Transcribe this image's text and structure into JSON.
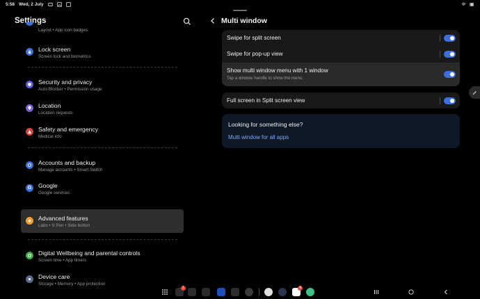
{
  "statusbar": {
    "time": "5:58",
    "date": "Wed, 2 July"
  },
  "left": {
    "title": "Settings",
    "items": [
      {
        "title": "",
        "sub": "Layout • App icon badges",
        "color": "#3d6fde"
      },
      {
        "title": "Lock screen",
        "sub": "Screen lock and biometrics",
        "color": "#3d6fde"
      },
      {
        "title": "Security and privacy",
        "sub": "Auto Blocker • Permission usage",
        "color": "#5b5fe0"
      },
      {
        "title": "Location",
        "sub": "Location requests",
        "color": "#7b5fd6"
      },
      {
        "title": "Safety and emergency",
        "sub": "Medical info",
        "color": "#d6443d"
      },
      {
        "title": "Accounts and backup",
        "sub": "Manage accounts • Smart Switch",
        "color": "#3d6fde"
      },
      {
        "title": "Google",
        "sub": "Google services",
        "color": "#3d6fde"
      },
      {
        "title": "Advanced features",
        "sub": "Labs • S Pen • Side button",
        "color": "#f0a030"
      },
      {
        "title": "Digital Wellbeing and parental controls",
        "sub": "Screen time • App timers",
        "color": "#3fae45"
      },
      {
        "title": "Device care",
        "sub": "Storage • Memory • App protection",
        "color": "#5a6a8c"
      }
    ]
  },
  "right": {
    "title": "Multi window",
    "rows": [
      {
        "label": "Swipe for split screen",
        "on": true
      },
      {
        "label": "Swipe for pop-up view",
        "on": true
      },
      {
        "label": "Show multi window menu with 1 window",
        "desc": "Tap a window handle to show the menu.",
        "on": true
      },
      {
        "label": "Full screen in Split screen view",
        "on": true
      }
    ],
    "card": {
      "question": "Looking for something else?",
      "link": "Multi window for all apps"
    }
  },
  "taskbar": {
    "badges": {
      "app2": "1",
      "gmail": "4"
    }
  },
  "colors": {
    "accent": "#3d6fde",
    "link": "#7fa8ff",
    "selected": "#2e2e2e"
  }
}
